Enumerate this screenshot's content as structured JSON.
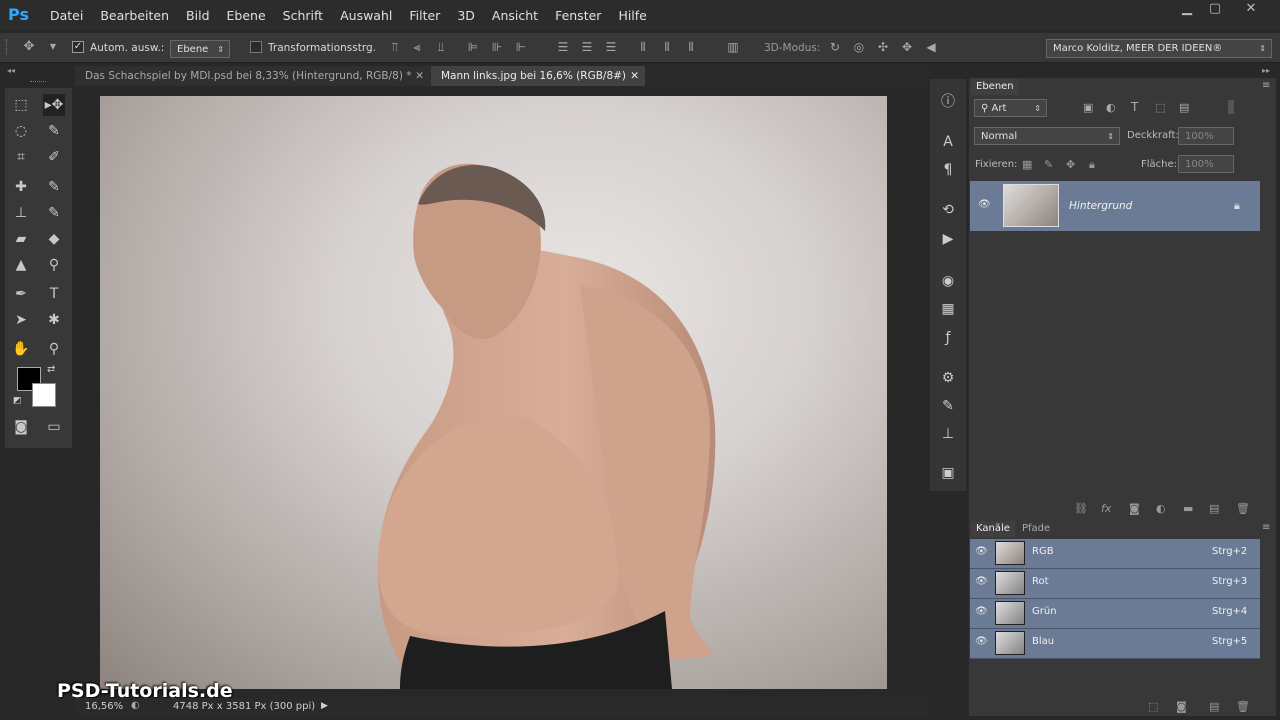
{
  "app": {
    "logo": "Ps"
  },
  "menu": [
    "Datei",
    "Bearbeiten",
    "Bild",
    "Ebene",
    "Schrift",
    "Auswahl",
    "Filter",
    "3D",
    "Ansicht",
    "Fenster",
    "Hilfe"
  ],
  "options": {
    "auto_select_label": "Autom. ausw.:",
    "auto_select_value": "Ebene",
    "transform_label": "Transformationsstrg.",
    "mode3d_label": "3D-Modus:",
    "workspace": "Marco Kolditz, MEER DER IDEEN®"
  },
  "tabs": [
    {
      "label": "Das Schachspiel by MDI.psd bei 8,33% (Hintergrund, RGB/8) *",
      "active": false
    },
    {
      "label": "Mann links.jpg bei 16,6% (RGB/8#)",
      "active": true
    }
  ],
  "status": {
    "zoom": "16,56%",
    "doc_info": "4748 Px x 3581 Px (300 ppi)"
  },
  "watermark": "PSD-Tutorials.de",
  "layers_panel": {
    "tab": "Ebenen",
    "filter_kind": "Art",
    "blend_mode": "Normal",
    "opacity_label": "Deckkraft:",
    "opacity_value": "100%",
    "lock_label": "Fixieren:",
    "fill_label": "Fläche:",
    "fill_value": "100%",
    "layers": [
      {
        "name": "Hintergrund",
        "locked": true
      }
    ]
  },
  "channels_panel": {
    "tabs": [
      "Kanäle",
      "Pfade"
    ],
    "channels": [
      {
        "name": "RGB",
        "shortcut": "Strg+2"
      },
      {
        "name": "Rot",
        "shortcut": "Strg+3"
      },
      {
        "name": "Grün",
        "shortcut": "Strg+4"
      },
      {
        "name": "Blau",
        "shortcut": "Strg+5"
      }
    ]
  },
  "colors": {
    "accent": "#31a8ff",
    "selection": "#6b7a95",
    "panel": "#383838"
  }
}
